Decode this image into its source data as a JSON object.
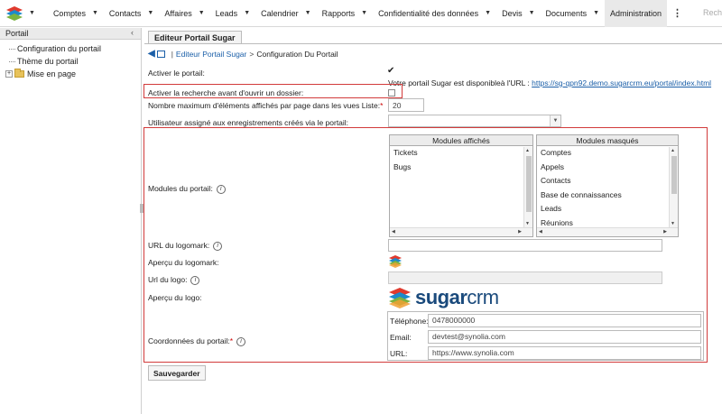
{
  "nav": {
    "items": [
      {
        "label": "Comptes"
      },
      {
        "label": "Contacts"
      },
      {
        "label": "Affaires"
      },
      {
        "label": "Leads"
      },
      {
        "label": "Calendrier"
      },
      {
        "label": "Rapports"
      },
      {
        "label": "Confidentialité des données"
      },
      {
        "label": "Devis"
      },
      {
        "label": "Documents"
      }
    ],
    "active_label": "Administration",
    "search_placeholder": "Rech"
  },
  "sidebar": {
    "title": "Portail",
    "items": [
      {
        "label": "Configuration du portail"
      },
      {
        "label": "Thème du portail"
      },
      {
        "label": "Mise en page"
      }
    ]
  },
  "main": {
    "tab": "Editeur Portail Sugar",
    "breadcrumb": {
      "link": "Editeur Portail Sugar",
      "separator": ">",
      "current": "Configuration Du Portail"
    },
    "activate_portal": {
      "label": "Activer le portail:",
      "checked": true
    },
    "portal_url": {
      "text": "Votre portail Sugar est disponibleà l'URL :",
      "link": "https://sg-qpn92.demo.sugarcrm.eu/portal/index.html"
    },
    "search_before_case": {
      "label": "Activer la recherche avant d'ouvrir un dossier:",
      "checked": false
    },
    "max_items": {
      "label": "Nombre maximum d'éléments affichés par page dans les vues Liste:",
      "value": "20"
    },
    "assigned_user": {
      "label": "Utilisateur assigné aux enregistrements créés via le portail:",
      "value": ""
    },
    "modules": {
      "label": "Modules du portail:",
      "shown_title": "Modules affichés",
      "shown": [
        "Tickets",
        "Bugs"
      ],
      "hidden_title": "Modules masqués",
      "hidden": [
        "Comptes",
        "Appels",
        "Contacts",
        "Base de connaissances",
        "Leads",
        "Réunions"
      ]
    },
    "logomark_url": {
      "label": "URL du logomark:",
      "value": ""
    },
    "logomark_preview": {
      "label": "Aperçu du logomark:"
    },
    "logo_url": {
      "label": "Url du logo:",
      "value": ""
    },
    "logo_preview": {
      "label": "Aperçu du logo:",
      "brand_sugar": "sugar",
      "brand_crm": "crm"
    },
    "contact": {
      "label": "Coordonnées du portail:",
      "phone_label": "Téléphone:",
      "phone": "0478000000",
      "email_label": "Email:",
      "email": "devtest@synolia.com",
      "url_label": "URL:",
      "url": "https://www.synolia.com"
    },
    "save_label": "Sauvegarder"
  },
  "colors": {
    "highlight": "#d23b3b",
    "link": "#1b5fa8"
  },
  "icons": [
    "sugar-logo-icon",
    "chevron-down-icon",
    "kebab-menu-icon",
    "collapse-icon",
    "folder-icon",
    "back-arrow-icon",
    "home-icon",
    "info-icon"
  ]
}
